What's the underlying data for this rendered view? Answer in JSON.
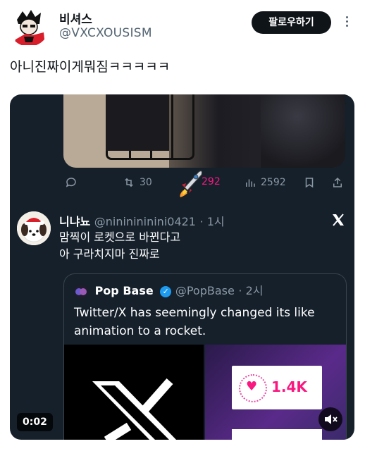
{
  "header": {
    "display_name": "비셔스",
    "handle": "@VXCXOUSISM",
    "follow_label": "팔로우하기"
  },
  "tweet": {
    "text": "아니진짜이게뭐짐ㅋㅋㅋㅋㅋ"
  },
  "media": {
    "actions": {
      "retweets": "30",
      "likes": "292",
      "views": "2592"
    },
    "reply": {
      "name": "니냐뇨",
      "handle": "@nininininini0421",
      "time": "· 1시",
      "line1": "맘찍이 로켓으로 바뀐다고",
      "line2": "아 구라치지마 진짜로"
    },
    "quote": {
      "name": "Pop Base",
      "handle": "@PopBase",
      "time": "· 2시",
      "text": "Twitter/X has seemingly changed its like animation to a rocket."
    },
    "like_count_card": "1.4K",
    "timer": "0:02"
  },
  "colors": {
    "like": "#f91880",
    "verified": "#1d9bf0",
    "follow_bg": "#0f1419",
    "media_bg": "#15202b"
  },
  "icons": [
    "more-icon",
    "reply-icon",
    "retweet-icon",
    "rocket-icon",
    "views-icon",
    "bookmark-icon",
    "share-icon",
    "x-logo-icon",
    "verified-icon",
    "mute-icon"
  ]
}
